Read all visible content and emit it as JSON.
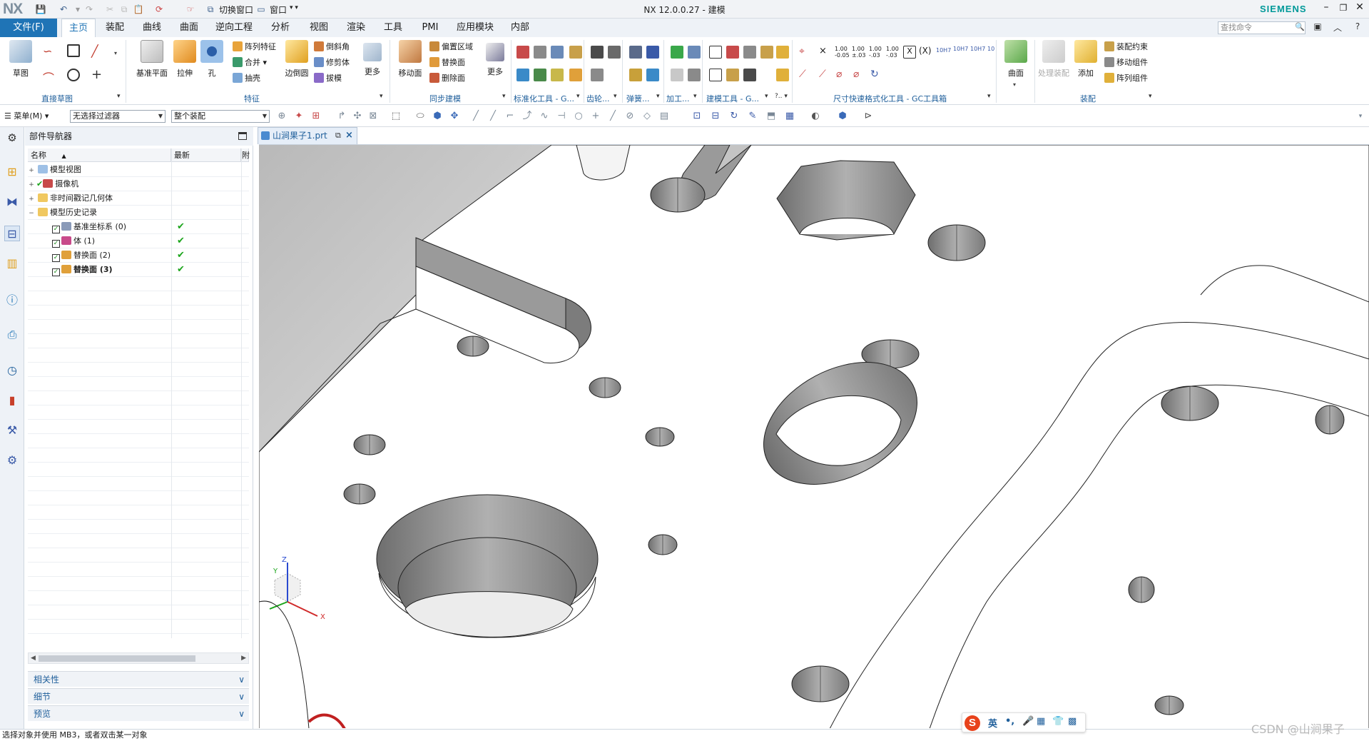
{
  "titlebar": {
    "logo": "NX",
    "switch_window_label": "切换窗口",
    "window_menu_label": "窗口",
    "title": "NX 12.0.0.27 - 建模",
    "brand": "SIEMENS"
  },
  "ribbon_tabs": {
    "file": "文件(F)",
    "tabs": [
      "主页",
      "装配",
      "曲线",
      "曲面",
      "逆向工程",
      "分析",
      "视图",
      "渲染",
      "工具",
      "PMI",
      "应用模块",
      "内部"
    ],
    "active_index": 0,
    "search_placeholder": "查找命令"
  },
  "ribbon": {
    "direct_sketch": {
      "sketch_label": "草图",
      "group_label": "直接草图"
    },
    "feature": {
      "datum_plane": "基准平面",
      "extrude": "拉伸",
      "hole": "孔",
      "pattern_feature": "阵列特征",
      "unite": "合并",
      "shell": "抽壳",
      "edge_blend": "边倒圆",
      "chamfer": "倒斜角",
      "trim_body": "修剪体",
      "draft": "拔模",
      "more": "更多",
      "group_label": "特征"
    },
    "sync_modeling": {
      "move_face": "移动面",
      "offset_region": "偏置区域",
      "replace_face": "替换面",
      "delete_face": "删除面",
      "more": "更多",
      "group_label": "同步建模"
    },
    "std_tools_label": "标准化工具 - G...",
    "gear_label": "齿轮...",
    "spring_label": "弹簧...",
    "machining_label": "加工...",
    "modeling_tools_label": "建模工具 - G...",
    "dim_tools_label": "尺寸快速格式化工具 - GC工具箱",
    "surface": {
      "label": "曲面"
    },
    "assembly": {
      "process_assembly": "处理装配",
      "add": "添加",
      "assembly_constraints": "装配约束",
      "move_component": "移动组件",
      "pattern_component": "阵列组件",
      "group_label": "装配"
    }
  },
  "toolbar2": {
    "menu_label": "菜单(M)",
    "filter_value": "无选择过滤器",
    "scope_value": "整个装配"
  },
  "navigator": {
    "title": "部件导航器",
    "columns": [
      "名称",
      "最新",
      "附"
    ],
    "tree": [
      {
        "label": "模型视图",
        "level": 0,
        "expand": "+",
        "checked": false,
        "latest": ""
      },
      {
        "label": "摄像机",
        "level": 0,
        "expand": "+",
        "checked": true,
        "latest": ""
      },
      {
        "label": "非时间戳记几何体",
        "level": 0,
        "expand": "+",
        "checked": false,
        "latest": ""
      },
      {
        "label": "模型历史记录",
        "level": 0,
        "expand": "−",
        "checked": false,
        "latest": ""
      },
      {
        "label": "基准坐标系 (0)",
        "level": 1,
        "expand": "",
        "checked": true,
        "latest": "✔"
      },
      {
        "label": "体 (1)",
        "level": 1,
        "expand": "",
        "checked": true,
        "latest": "✔"
      },
      {
        "label": "替换面 (2)",
        "level": 1,
        "expand": "",
        "checked": true,
        "latest": "✔"
      },
      {
        "label": "替换面 (3)",
        "level": 1,
        "expand": "",
        "checked": true,
        "latest": "✔",
        "bold": true
      }
    ],
    "panels": [
      "相关性",
      "细节",
      "预览"
    ]
  },
  "document_tab": {
    "label": "山涧果子1.prt"
  },
  "triad": {
    "x": "X",
    "y": "Y",
    "z": "Z"
  },
  "status_text": "选择对象并使用 MB3，或者双击某一对象",
  "ime": {
    "logo": "S",
    "mode": "英",
    "punct": "•,"
  },
  "watermark": "CSDN @山涧果子",
  "colors": {
    "file_tab": "#1f74b6",
    "brand": "#009999",
    "check_green": "#1ca51c",
    "hole_grey": "#8e8e8e"
  }
}
